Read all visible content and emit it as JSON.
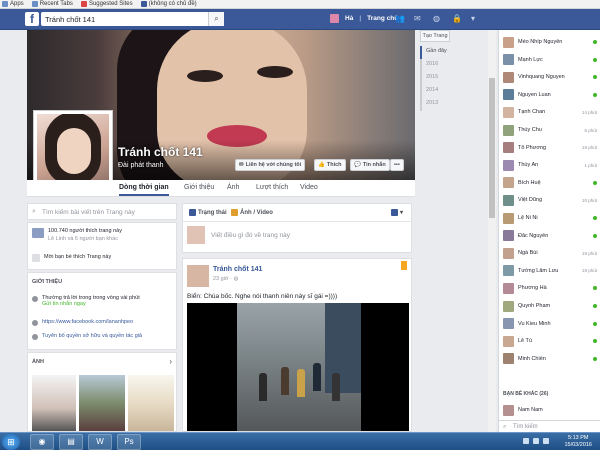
{
  "bookmarks": [
    {
      "icon": "apps-icon",
      "label": "Apps"
    },
    {
      "icon": "recent-tabs-icon",
      "label": "Recent Tabs"
    },
    {
      "icon": "suggested-sites-icon",
      "label": "Suggested Sites"
    },
    {
      "icon": "facebook-icon",
      "label": "(không có chủ đề)"
    }
  ],
  "header": {
    "search_value": "Tránh chốt 141",
    "user_name": "Hà",
    "home_label": "Trang chủ",
    "accent": "#3b5998"
  },
  "profile": {
    "name": "Tránh chốt 141",
    "category": "Đài phát thanh",
    "buttons": {
      "contact": "Liên hệ với chúng tôi",
      "like": "Thích",
      "message": "Tin nhắn",
      "more": "•••"
    },
    "tabs": [
      "Dòng thời gian",
      "Giới thiệu",
      "Ảnh",
      "Lượt thích",
      "Video"
    ]
  },
  "timeline_nav": {
    "create_label": "Tạo Trang",
    "years": [
      "Gần đây",
      "2016",
      "2015",
      "2014",
      "2013"
    ]
  },
  "left": {
    "search_placeholder": "Tìm kiếm bài viết trên Trang này",
    "likes_count": "100.740 người thích trang này",
    "likes_friends": "Lê Linh và 6 người bạn khác",
    "invite": "Mời bạn bè thích Trang này",
    "intro_title": "GIỚI THIỆU",
    "response": "Thường trả lời trong trong vòng vài phút",
    "send_message": "Gửi tin nhắn ngay",
    "url": "https://www.facebook.com/lananhpeo",
    "ownership": "Tuyên bố quyền sở hữu và quyền tác giả",
    "photos_title": "ẢNH"
  },
  "composer": {
    "status_tab": "Trạng thái",
    "photo_tab": "Ảnh / Video",
    "placeholder": "Viết điều gì đó về trang này"
  },
  "post": {
    "author": "Tránh chốt 141",
    "time": "23 giờ",
    "text": "Biển: Chúa bốc. Nghe nói thanh niên này sĩ gái =))))"
  },
  "chat": {
    "contacts": [
      {
        "name": "Méo Nhíp Nguyễn",
        "status": "online"
      },
      {
        "name": "Mạnh Lực",
        "status": "online"
      },
      {
        "name": "Vinhquang Nguyen",
        "status": "online"
      },
      {
        "name": "Nguyen Luan",
        "status": "online"
      },
      {
        "name": "Tạnh Chan",
        "status": "14 phút"
      },
      {
        "name": "Thủy Chu",
        "status": "6 phút"
      },
      {
        "name": "Tô Phương",
        "status": "19 phút"
      },
      {
        "name": "Thùy An",
        "status": "1 phút"
      },
      {
        "name": "Bích Huệ",
        "status": "online"
      },
      {
        "name": "Việt Dũng",
        "status": "10 phút"
      },
      {
        "name": "Lệ Ni Ni",
        "status": "online"
      },
      {
        "name": "Đắc Nguyễn",
        "status": "online"
      },
      {
        "name": "Ngà Bùi",
        "status": "19 phút"
      },
      {
        "name": "Tường Lâm Lưu",
        "status": "19 phút"
      },
      {
        "name": "Phương Hà",
        "status": "online"
      },
      {
        "name": "Quynh Pham",
        "status": "online"
      },
      {
        "name": "Vu Kieu Minh",
        "status": "online"
      },
      {
        "name": "Lê Tú",
        "status": "online"
      },
      {
        "name": "Minh Chiến",
        "status": "online"
      }
    ],
    "more_header": "BẠN BÈ KHÁC (26)",
    "more_contact": "Nam Nam",
    "search_placeholder": "Tìm kiếm"
  },
  "taskbar": {
    "time": "5:13 PM",
    "date": "15/03/2016",
    "apps": [
      "chrome-icon",
      "explorer-icon",
      "word-icon",
      "photoshop-icon"
    ]
  }
}
